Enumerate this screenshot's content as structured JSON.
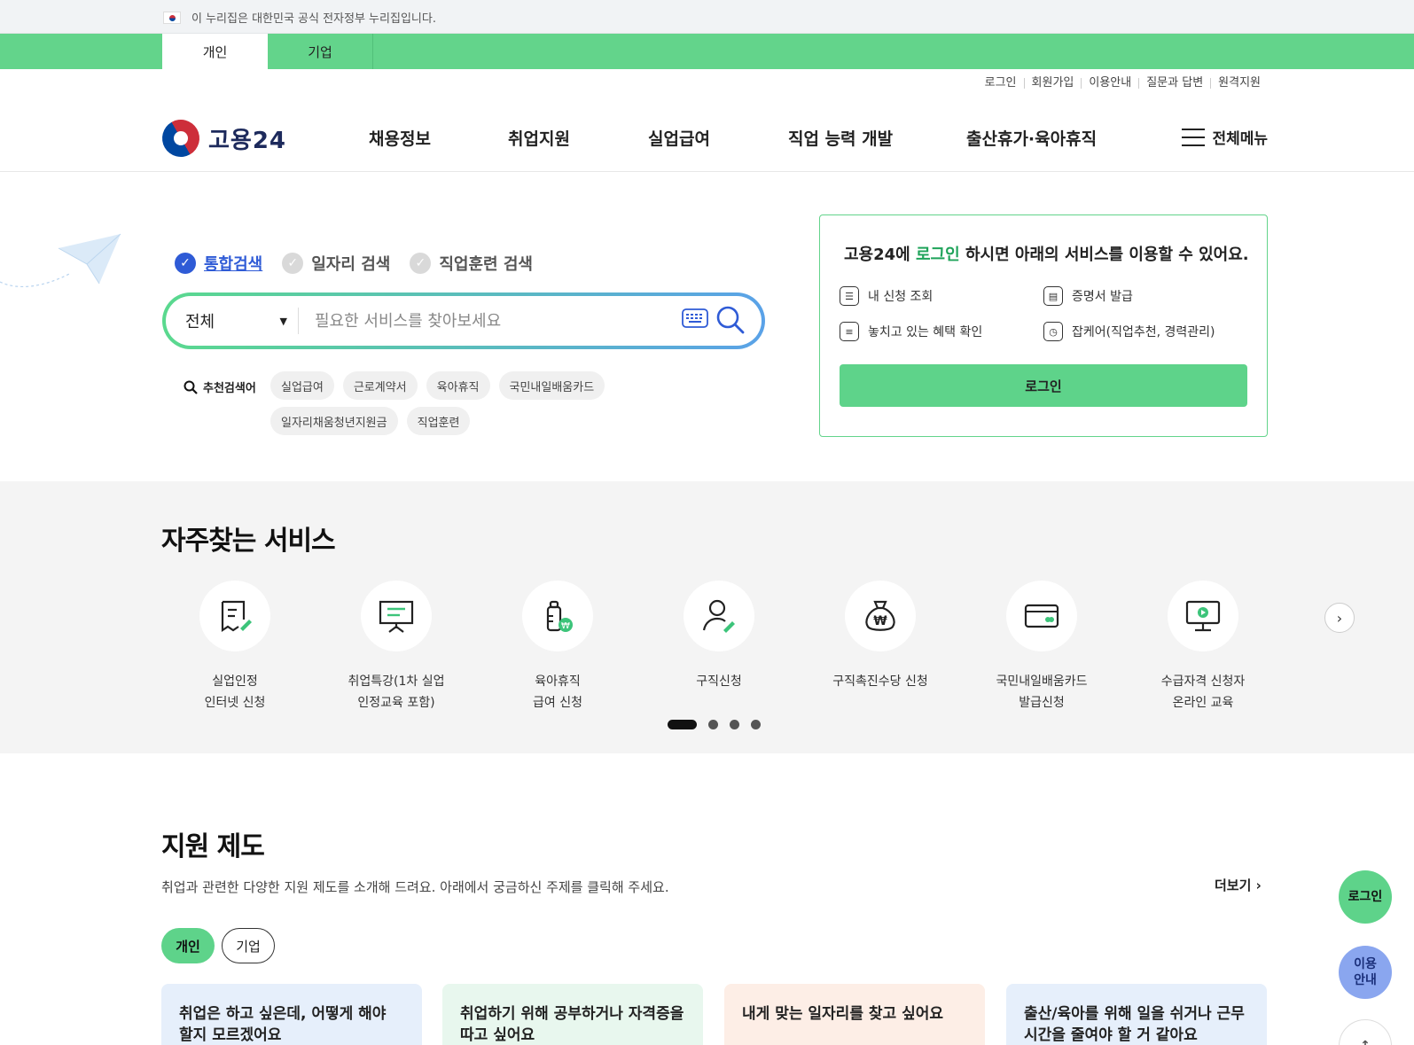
{
  "gov_banner": {
    "text": "이 누리집은 대한민국 공식 전자정부 누리집입니다."
  },
  "tabs": [
    {
      "label": "개인"
    },
    {
      "label": "기업"
    }
  ],
  "util_links": [
    {
      "label": "로그인"
    },
    {
      "label": "회원가입"
    },
    {
      "label": "이용안내"
    },
    {
      "label": "질문과 답변"
    },
    {
      "label": "원격지원"
    }
  ],
  "logo": {
    "text": "고용24"
  },
  "gnb": [
    {
      "label": "채용정보"
    },
    {
      "label": "취업지원"
    },
    {
      "label": "실업급여"
    },
    {
      "label": "직업 능력 개발"
    },
    {
      "label": "출산휴가·육아휴직"
    }
  ],
  "all_menu": {
    "label": "전체메뉴"
  },
  "search": {
    "options": [
      {
        "label": "통합검색"
      },
      {
        "label": "일자리 검색"
      },
      {
        "label": "직업훈련 검색"
      }
    ],
    "select_value": "전체",
    "placeholder": "필요한 서비스를 찾아보세요",
    "recommend_label": "추천검색어",
    "recommend": [
      {
        "label": "실업급여"
      },
      {
        "label": "근로계약서"
      },
      {
        "label": "육아휴직"
      },
      {
        "label": "국민내일배움카드"
      },
      {
        "label": "일자리채움청년지원금"
      },
      {
        "label": "직업훈련"
      }
    ]
  },
  "login_box": {
    "title_pre": "고용24에 ",
    "title_hl": "로그인",
    "title_post": " 하시면 아래의 서비스를 이용할 수 있어요.",
    "services": [
      {
        "label": "내 신청 조회"
      },
      {
        "label": "증명서 발급"
      },
      {
        "label": "놓치고 있는 혜택 확인"
      },
      {
        "label": "잡케어(직업추천, 경력관리)"
      }
    ],
    "button": "로그인"
  },
  "frequent": {
    "title": "자주찾는 서비스",
    "items": [
      {
        "label": "실업인정\n인터넷 신청"
      },
      {
        "label": "취업특강(1차 실업\n인정교육 포함)"
      },
      {
        "label": "육아휴직\n급여 신청"
      },
      {
        "label": "구직신청"
      },
      {
        "label": "구직촉진수당 신청"
      },
      {
        "label": "국민내일배움카드\n발급신청"
      },
      {
        "label": "수급자격 신청자\n온라인 교육"
      }
    ]
  },
  "support": {
    "title": "지원 제도",
    "desc": "취업과 관련한 다양한 지원 제도를 소개해 드려요. 아래에서 궁금하신 주제를 클릭해 주세요.",
    "more": "더보기",
    "pills": [
      {
        "label": "개인"
      },
      {
        "label": "기업"
      }
    ],
    "cards": [
      {
        "label": "취업은 하고 싶은데, 어떻게 해야 할지 모르겠어요"
      },
      {
        "label": "취업하기 위해 공부하거나 자격증을 따고 싶어요"
      },
      {
        "label": "내게 맞는 일자리를 찾고 싶어요"
      },
      {
        "label": "출산/육아를 위해 일을 쉬거나 근무시간을 줄여야 할 거 같아요"
      }
    ]
  },
  "floating": {
    "login": "로그인",
    "guide": "이용\n안내"
  },
  "colors": {
    "brand_green": "#5ed38a",
    "brand_blue": "#2f5bd6",
    "highlight_green": "#1fa35a"
  }
}
